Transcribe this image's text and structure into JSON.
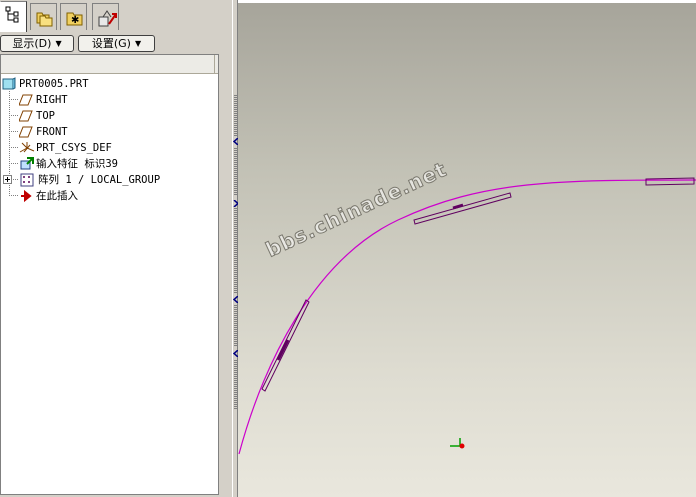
{
  "model_tree": {
    "tabs": [
      {
        "icon": "model-tree-icon"
      },
      {
        "icon": "folder-browser-icon"
      },
      {
        "icon": "favorites-folder-icon"
      },
      {
        "icon": "connections-icon"
      }
    ],
    "display_menu": "显示(D)",
    "settings_menu": "设置(G)",
    "items": [
      {
        "label": "PRT0005.PRT",
        "icon": "part-icon"
      },
      {
        "label": "RIGHT",
        "icon": "datum-plane-icon"
      },
      {
        "label": "TOP",
        "icon": "datum-plane-icon"
      },
      {
        "label": "FRONT",
        "icon": "datum-plane-icon"
      },
      {
        "label": "PRT_CSYS_DEF",
        "icon": "csys-icon"
      },
      {
        "label": "输入特征 标识39",
        "icon": "import-feature-icon"
      },
      {
        "label": "阵列 1 / LOCAL_GROUP",
        "icon": "pattern-icon"
      },
      {
        "label": "在此插入",
        "icon": "insert-here-arrow-icon"
      }
    ]
  },
  "watermark": "bbs.chinade.net",
  "colors": {
    "curve": "#cc00cc",
    "panel_bg": "#d4d0c8",
    "viewport_top": "#a6a49a",
    "viewport_bottom": "#e9e7dd"
  }
}
